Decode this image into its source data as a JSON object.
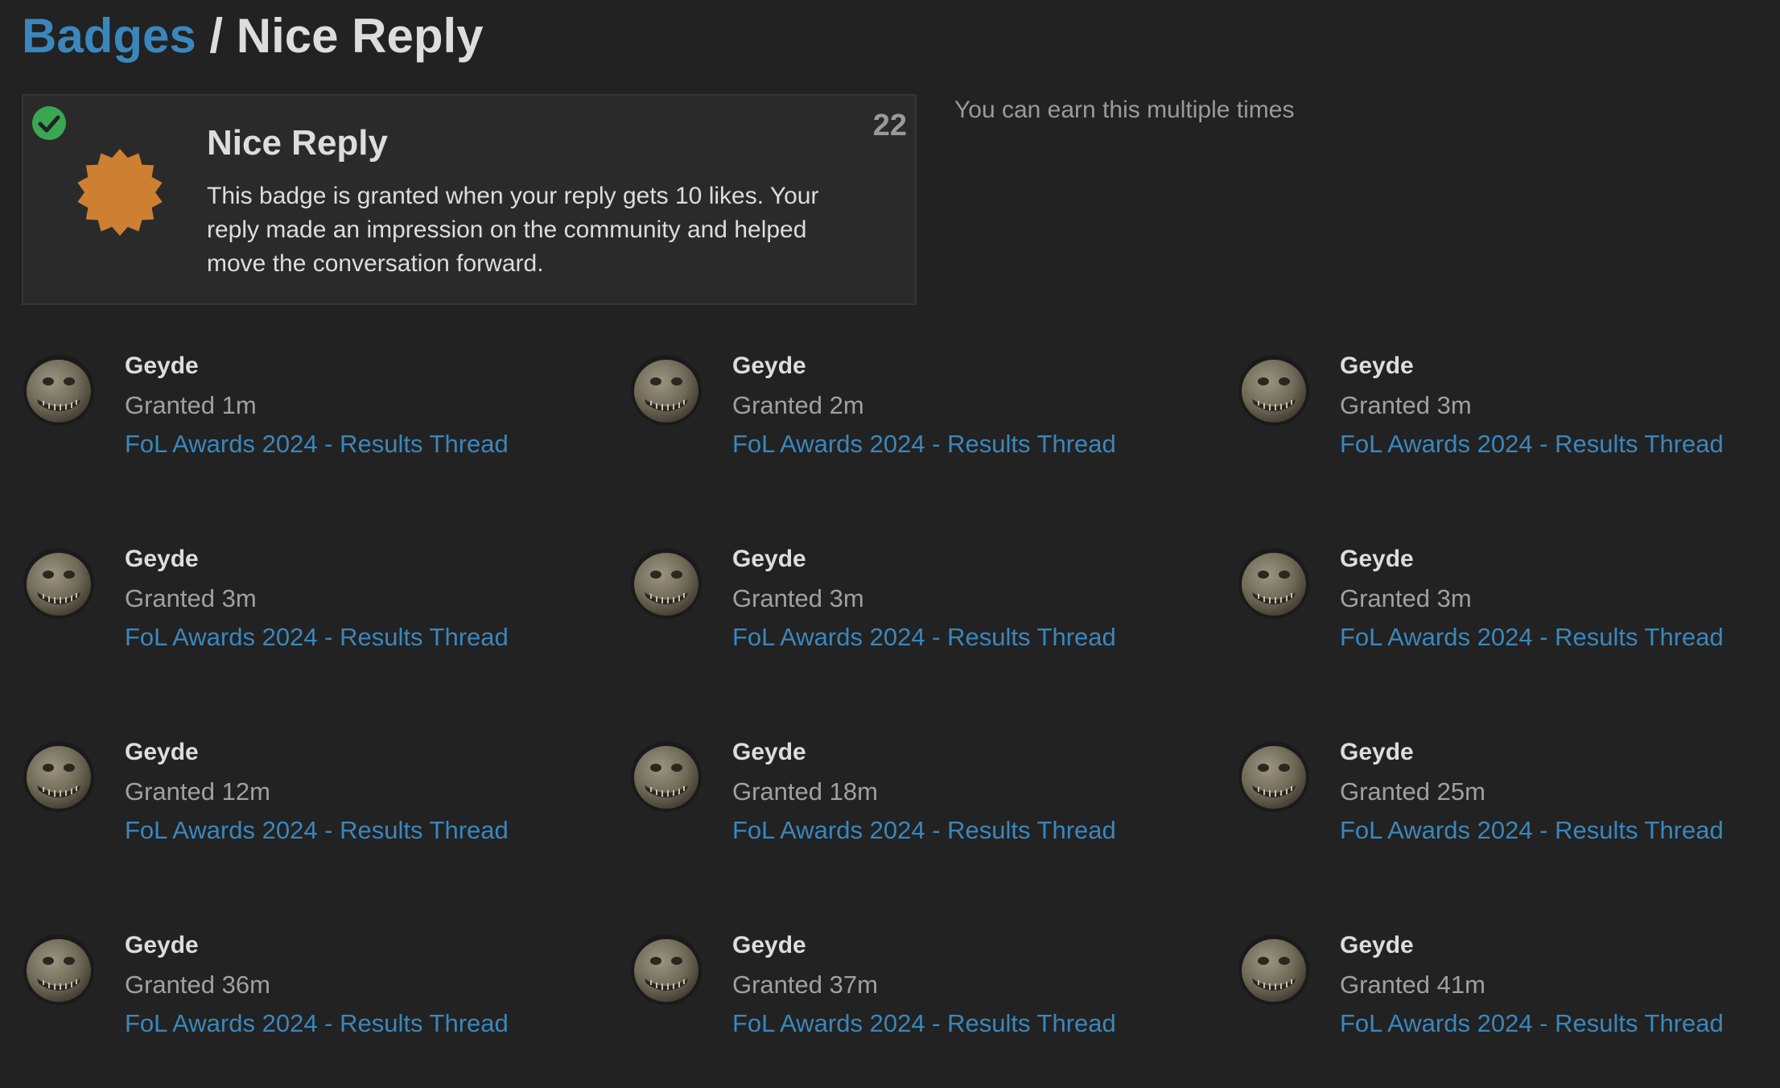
{
  "breadcrumb": {
    "badges_link": "Badges",
    "separator": "/",
    "current": "Nice Reply"
  },
  "badge": {
    "name": "Nice Reply",
    "count": "22",
    "description": "This badge is granted when your reply gets 10 likes. Your reply made an impression on the community and helped move the conversation forward.",
    "icon": "certificate-icon",
    "icon_color": "#cd7f32",
    "granted_icon": "check-circle-icon",
    "granted_color": "#3aa752"
  },
  "earn_note": "You can earn this multiple times",
  "colors": {
    "background": "#222222",
    "link": "#3a87bd",
    "text": "#dddddd",
    "muted": "#a0a0a0"
  },
  "grants": [
    {
      "user": "Geyde",
      "time": "Granted 1m",
      "topic": "FoL Awards 2024 - Results Thread"
    },
    {
      "user": "Geyde",
      "time": "Granted 2m",
      "topic": "FoL Awards 2024 - Results Thread"
    },
    {
      "user": "Geyde",
      "time": "Granted 3m",
      "topic": "FoL Awards 2024 - Results Thread"
    },
    {
      "user": "Geyde",
      "time": "Granted 3m",
      "topic": "FoL Awards 2024 - Results Thread"
    },
    {
      "user": "Geyde",
      "time": "Granted 3m",
      "topic": "FoL Awards 2024 - Results Thread"
    },
    {
      "user": "Geyde",
      "time": "Granted 3m",
      "topic": "FoL Awards 2024 - Results Thread"
    },
    {
      "user": "Geyde",
      "time": "Granted 12m",
      "topic": "FoL Awards 2024 - Results Thread"
    },
    {
      "user": "Geyde",
      "time": "Granted 18m",
      "topic": "FoL Awards 2024 - Results Thread"
    },
    {
      "user": "Geyde",
      "time": "Granted 25m",
      "topic": "FoL Awards 2024 - Results Thread"
    },
    {
      "user": "Geyde",
      "time": "Granted 36m",
      "topic": "FoL Awards 2024 - Results Thread"
    },
    {
      "user": "Geyde",
      "time": "Granted 37m",
      "topic": "FoL Awards 2024 - Results Thread"
    },
    {
      "user": "Geyde",
      "time": "Granted 41m",
      "topic": "FoL Awards 2024 - Results Thread"
    }
  ]
}
